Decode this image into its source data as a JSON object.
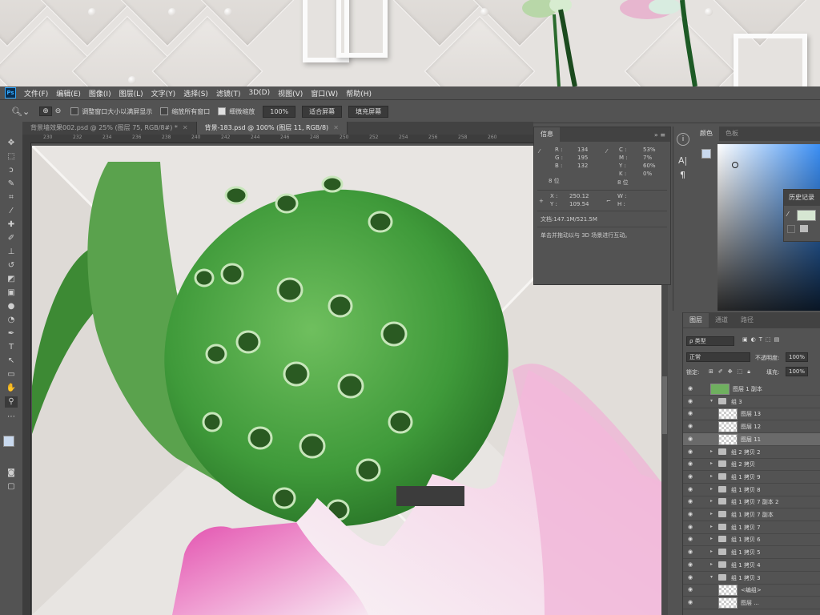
{
  "menubar": {
    "logo": "Ps",
    "items": [
      "文件(F)",
      "编辑(E)",
      "图像(I)",
      "图层(L)",
      "文字(Y)",
      "选择(S)",
      "滤镜(T)",
      "3D(D)",
      "视图(V)",
      "窗口(W)",
      "帮助(H)"
    ]
  },
  "options": {
    "resize_windows": "调整窗口大小以满屏显示",
    "zoom_all": "缩放所有窗口",
    "scrubby_zoom": "细微缩放",
    "zoom_value": "100%",
    "fit_screen": "适合屏幕",
    "fill_screen": "填充屏幕"
  },
  "tabs": [
    {
      "label": "背景墙效果002.psd @ 25% (图层 75, RGB/8#) *"
    },
    {
      "label": "背景-183.psd @ 100% (图层 11, RGB/8)"
    }
  ],
  "ruler": {
    "ticks": [
      "230",
      "232",
      "234",
      "236",
      "238",
      "240",
      "242",
      "244",
      "246",
      "248",
      "250",
      "252",
      "254",
      "256",
      "258",
      "260"
    ]
  },
  "info": {
    "tabs": [
      "信息"
    ],
    "r_label": "R :",
    "r": "134",
    "g_label": "G :",
    "g": "195",
    "b_label": "B :",
    "b": "132",
    "bits1": "8 位",
    "c_label": "C :",
    "c": "53%",
    "m_label": "M :",
    "m": "7%",
    "y_label": "Y :",
    "y": "60%",
    "k_label": "K :",
    "k": "0%",
    "bits2": "8 位",
    "x_label": "X :",
    "x": "250.12",
    "yy_label": "Y :",
    "yy": "109.54",
    "w_label": "W :",
    "h_label": "H :",
    "doc": "文档:147.1M/521.5M",
    "hint": "单击并拖动以与 3D 场景进行互动。"
  },
  "color": {
    "tabs": [
      "颜色",
      "色板"
    ],
    "fg": "#c9d9ee",
    "bg": "#ffffff"
  },
  "history": {
    "title": "历史记录"
  },
  "layers": {
    "tabs": [
      "图层",
      "通道",
      "路径"
    ],
    "kind": "ρ 类型",
    "blend": "正常",
    "opacity_label": "不透明度:",
    "opacity": "100%",
    "lock_label": "锁定:",
    "fill_label": "填充:",
    "fill": "100%",
    "items": [
      {
        "name": "图层 1 副本",
        "type": "layer",
        "indent": 0
      },
      {
        "name": "组 3",
        "type": "group-open",
        "indent": 0
      },
      {
        "name": "图层 13",
        "type": "layer",
        "indent": 1
      },
      {
        "name": "图层 12",
        "type": "layer",
        "indent": 1
      },
      {
        "name": "图层 11",
        "type": "layer",
        "indent": 1,
        "selected": true
      },
      {
        "name": "组 2 拷贝 2",
        "type": "group",
        "indent": 0
      },
      {
        "name": "组 2 拷贝",
        "type": "group",
        "indent": 0
      },
      {
        "name": "组 1 拷贝 9",
        "type": "group",
        "indent": 0
      },
      {
        "name": "组 1 拷贝 8",
        "type": "group",
        "indent": 0
      },
      {
        "name": "组 1 拷贝 7 副本 2",
        "type": "group",
        "indent": 0
      },
      {
        "name": "组 1 拷贝 7 副本",
        "type": "group",
        "indent": 0
      },
      {
        "name": "组 1 拷贝 7",
        "type": "group",
        "indent": 0
      },
      {
        "name": "组 1 拷贝 6",
        "type": "group",
        "indent": 0
      },
      {
        "name": "组 1 拷贝 5",
        "type": "group",
        "indent": 0
      },
      {
        "name": "组 1 拷贝 4",
        "type": "group",
        "indent": 0
      },
      {
        "name": "组 1 拷贝 3",
        "type": "group-open",
        "indent": 0
      },
      {
        "name": "<编组>",
        "type": "layer",
        "indent": 1
      },
      {
        "name": "图层 ...",
        "type": "layer",
        "indent": 1
      }
    ]
  }
}
